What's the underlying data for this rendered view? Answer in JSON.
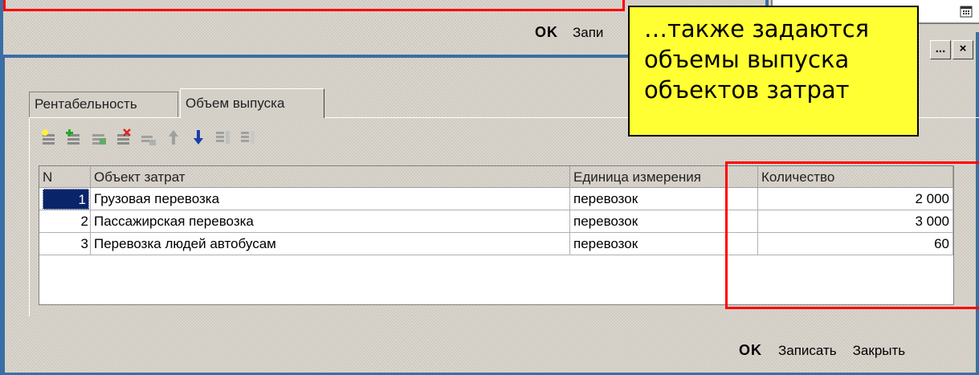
{
  "popup": {
    "ok": "OK",
    "save_partial": "Запи"
  },
  "tabs": [
    {
      "label": "Рентабельность"
    },
    {
      "label": "Объем выпуска"
    }
  ],
  "callout": {
    "line1": "…также задаются",
    "line2": "объемы выпуска",
    "line3": "объектов затрат"
  },
  "window_buttons": {
    "select": "...",
    "close": "×"
  },
  "table": {
    "headers": [
      "N",
      "Объект затрат",
      "Единица измерения",
      "Количество"
    ],
    "rows": [
      {
        "n": "1",
        "object": "Грузовая перевозка",
        "unit": "перевозок",
        "qty": "2 000"
      },
      {
        "n": "2",
        "object": "Пассажирская перевозка",
        "unit": "перевозок",
        "qty": "3 000"
      },
      {
        "n": "3",
        "object": "Перевозка людей автобусам",
        "unit": "перевозок",
        "qty": "60"
      }
    ]
  },
  "footer": {
    "ok": "OK",
    "save": "Записать",
    "close": "Закрыть"
  },
  "toolbar_icons": [
    "add-row-icon",
    "add-group-icon",
    "copy-row-icon",
    "delete-row-icon",
    "fill-icon",
    "move-up-icon",
    "move-down-icon",
    "sort-asc-icon",
    "sort-desc-icon"
  ],
  "colors": {
    "window_frame": "#3a6ea5",
    "highlight": "#ff0000",
    "callout": "#ffff33",
    "selected_cell": "#0a246a"
  }
}
